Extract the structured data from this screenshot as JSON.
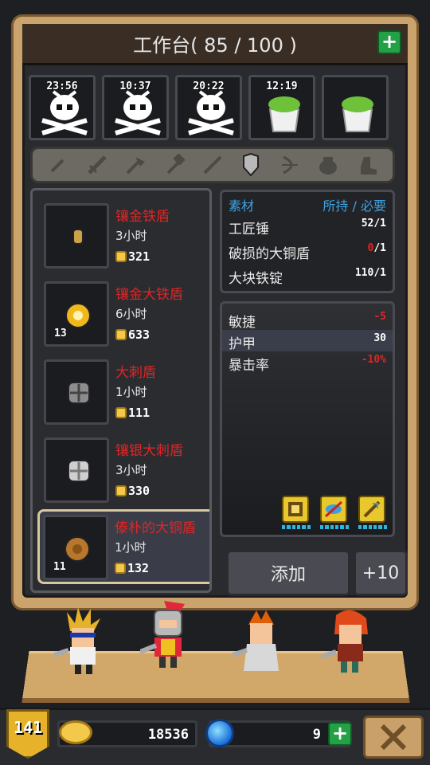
{
  "header": {
    "title": "工作台( 85 / 100 )",
    "add_icon": "plus-icon"
  },
  "slots": [
    {
      "time": "23:56",
      "icon": "skull-crossbones-icon"
    },
    {
      "time": "10:37",
      "icon": "skull-crossbones-icon"
    },
    {
      "time": "20:22",
      "icon": "skull-crossbones-icon"
    },
    {
      "time": "12:19",
      "icon": "herb-pot-icon"
    },
    {
      "time": "",
      "icon": "herb-pot-icon"
    }
  ],
  "categories": [
    {
      "icon": "dagger-icon"
    },
    {
      "icon": "sword-icon"
    },
    {
      "icon": "axe-icon"
    },
    {
      "icon": "hammer-icon"
    },
    {
      "icon": "staff-icon"
    },
    {
      "icon": "shield-icon",
      "selected": true
    },
    {
      "icon": "bow-icon"
    },
    {
      "icon": "pot-icon"
    },
    {
      "icon": "boot-icon"
    }
  ],
  "recipes": [
    {
      "name": "镶金铁盾",
      "duration": "3小时",
      "cost": "321",
      "count": "",
      "icon": "small-gold-shield-icon"
    },
    {
      "name": "镶金大铁盾",
      "duration": "6小时",
      "cost": "633",
      "count": "13",
      "icon": "gold-round-shield-icon"
    },
    {
      "name": "大刺盾",
      "duration": "1小时",
      "cost": "111",
      "count": "",
      "icon": "spiked-shield-icon"
    },
    {
      "name": "镶银大刺盾",
      "duration": "3小时",
      "cost": "330",
      "count": "",
      "icon": "silver-spiked-shield-icon"
    },
    {
      "name": "傣朴的大铜盾",
      "duration": "1小时",
      "cost": "132",
      "count": "11",
      "icon": "bronze-shield-icon"
    }
  ],
  "materials": {
    "header_left": "素材",
    "header_right": "所持 / 必要",
    "rows": [
      {
        "name": "工匠锤",
        "have": "52",
        "need": "/1",
        "short": false
      },
      {
        "name": "破损的大铜盾",
        "have": "0",
        "need": "/1",
        "short": true
      },
      {
        "name": "大块铁锭",
        "have": "110",
        "need": "/1",
        "short": false
      }
    ]
  },
  "stats": [
    {
      "name": "敏捷",
      "value": "-5",
      "negative": true
    },
    {
      "name": "护甲",
      "value": "30",
      "negative": false
    },
    {
      "name": "暴击率",
      "value": "-10%",
      "negative": true
    }
  ],
  "skills": [
    "skill-book-icon",
    "skill-eye-icon",
    "skill-sword-icon"
  ],
  "actions": {
    "add": "添加",
    "plus10": "+10"
  },
  "footer": {
    "level": "141",
    "gold": "18536",
    "gems": "9",
    "close_icon": "close-icon"
  },
  "colors": {
    "accent_red": "#e12525",
    "accent_blue": "#3fa2e0",
    "frame_tan": "#caa46c",
    "green_button": "#24a047"
  }
}
